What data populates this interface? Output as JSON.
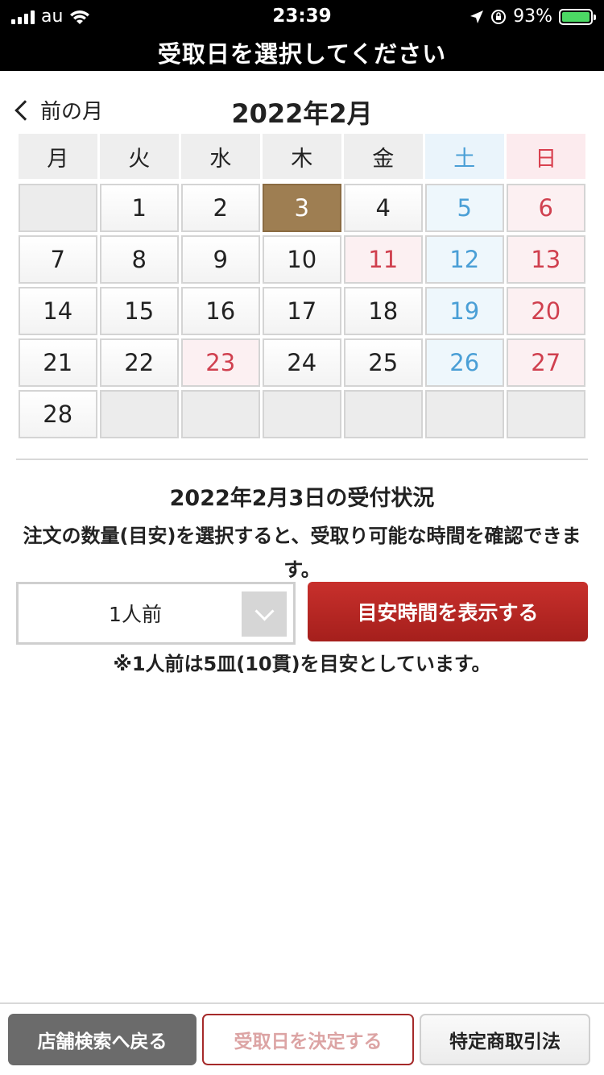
{
  "status_bar": {
    "carrier": "au",
    "time": "23:39",
    "battery": "93%"
  },
  "header": {
    "title": "受取日を選択してください"
  },
  "calendar": {
    "prev_label": "前の月",
    "month_title": "2022年2月",
    "weekdays": [
      "月",
      "火",
      "水",
      "木",
      "金",
      "土",
      "日"
    ],
    "days": [
      "",
      "1",
      "2",
      "3",
      "4",
      "5",
      "6",
      "7",
      "8",
      "9",
      "10",
      "11",
      "12",
      "13",
      "14",
      "15",
      "16",
      "17",
      "18",
      "19",
      "20",
      "21",
      "22",
      "23",
      "24",
      "25",
      "26",
      "27",
      "28",
      "",
      "",
      "",
      "",
      "",
      ""
    ],
    "holidays": [
      "11",
      "23"
    ],
    "selected_day": "3",
    "colors": {
      "selected": "#9e7e52",
      "saturday": "#4a9fd6",
      "sunday_holiday": "#d0404f"
    }
  },
  "reception": {
    "title": "2022年2月3日の受付状況",
    "description": "注文の数量(目安)を選択すると、受取り可能な時間を確認できます。",
    "quantity_select": {
      "value": "1人前"
    },
    "show_button": "目安時間を表示する",
    "note": "※1人前は5皿(10貫)を目安としています。"
  },
  "footer": {
    "back_label": "店舗検索へ戻る",
    "decide_label": "受取日を決定する",
    "law_label": "特定商取引法"
  }
}
